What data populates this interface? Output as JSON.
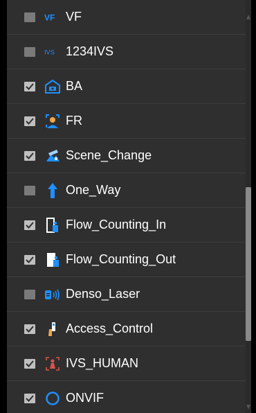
{
  "items": [
    {
      "label": "VF",
      "checked": false,
      "icon": "vf-text-icon",
      "icon_text": "VF"
    },
    {
      "label": "1234IVS",
      "checked": false,
      "icon": "ivs-text-icon",
      "icon_text": "IVS"
    },
    {
      "label": "BA",
      "checked": true,
      "icon": "ba-camera-icon"
    },
    {
      "label": "FR",
      "checked": true,
      "icon": "face-recognition-icon"
    },
    {
      "label": "Scene_Change",
      "checked": true,
      "icon": "scene-change-icon"
    },
    {
      "label": "One_Way",
      "checked": false,
      "icon": "one-way-arrow-icon"
    },
    {
      "label": "Flow_Counting_In",
      "checked": true,
      "icon": "flow-counting-in-icon"
    },
    {
      "label": "Flow_Counting_Out",
      "checked": true,
      "icon": "flow-counting-out-icon"
    },
    {
      "label": "Denso_Laser",
      "checked": false,
      "icon": "laser-icon"
    },
    {
      "label": "Access_Control",
      "checked": true,
      "icon": "access-control-icon"
    },
    {
      "label": "IVS_HUMAN",
      "checked": true,
      "icon": "human-detection-icon"
    },
    {
      "label": "ONVIF",
      "checked": true,
      "icon": "onvif-ring-icon"
    }
  ],
  "colors": {
    "background": "#2f2f2f",
    "text": "#ffffff",
    "checkbox_checked": "#bfbfbf",
    "checkbox_unchecked": "#7a7a7a",
    "accent": "#1e90ff"
  }
}
